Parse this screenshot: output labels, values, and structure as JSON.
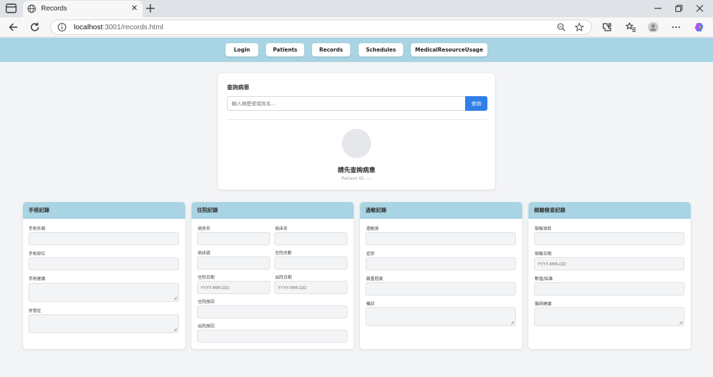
{
  "browser": {
    "tab_title": "Records",
    "url_host": "localhost",
    "url_path": ":3001/records.html"
  },
  "nav": {
    "items": [
      "Login",
      "Patients",
      "Records",
      "Schedules",
      "MedicalResourceUsage"
    ]
  },
  "search": {
    "heading": "查詢病患",
    "placeholder": "輸入病歷號或姓名...",
    "button_label": "查詢",
    "prompt": "請先查詢病患",
    "patient_id": "Patient ID: ---"
  },
  "cards": {
    "surgery": {
      "title": "手術記錄",
      "name_label": "手術名稱",
      "site_label": "手術部位",
      "advice_label": "手術建議",
      "complication_label": "併發症"
    },
    "admission": {
      "title": "住院記錄",
      "ward_label": "病房名",
      "bed_label": "病床名",
      "bed_no_label": "病床號",
      "days_label": "住院天數",
      "admit_date_label": "住院日期",
      "discharge_date_label": "出院日期",
      "admit_date_placeholder": "YYYY-MM-DD",
      "discharge_date_placeholder": "YYYY-MM-DD",
      "admit_reason_label": "住院原因",
      "discharge_reason_label": "出院原因"
    },
    "allergy": {
      "title": "過敏記錄",
      "allergen_label": "過敏原",
      "symptom_label": "症狀",
      "severity_label": "嚴重程度",
      "notes_label": "備註"
    },
    "lab": {
      "title": "檢驗檢查記錄",
      "item_label": "檢驗項目",
      "date_label": "檢驗日期",
      "date_placeholder": "YYYY-MM-DD",
      "result_label": "數值/結果",
      "advice_label": "醫師建議"
    }
  },
  "colors": {
    "accent_header": "#a8d4e3",
    "primary_button": "#2f7fe8"
  }
}
